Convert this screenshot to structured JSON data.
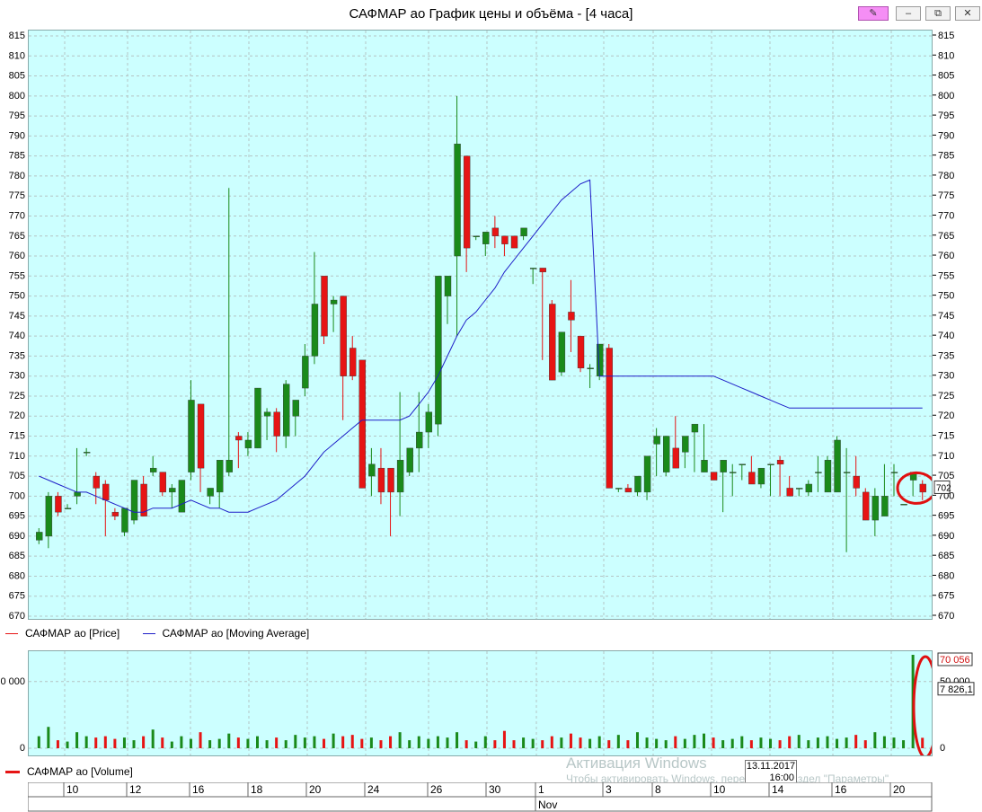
{
  "window": {
    "title": "САФМАР ао График цены и объёма - [4 часа]",
    "buttons": [
      "pin",
      "minimize",
      "restore",
      "close"
    ]
  },
  "legend": {
    "price": "САФМАР ао [Price]",
    "ma": "САФМАР ао [Moving Average]",
    "volume": "САФМАР ао [Volume]"
  },
  "price_axis": {
    "labels": [
      "815",
      "810",
      "805",
      "800",
      "795",
      "790",
      "785",
      "780",
      "775",
      "770",
      "765",
      "760",
      "755",
      "750",
      "745",
      "740",
      "735",
      "730",
      "725",
      "720",
      "715",
      "710",
      "705",
      "700",
      "695",
      "690",
      "685",
      "680",
      "675",
      "670"
    ],
    "current_label": "702"
  },
  "volume_axis": {
    "left_labels": [
      "0 000",
      "0"
    ],
    "right_labels": [
      "70 056",
      "50 000",
      "7 826,1",
      "0"
    ]
  },
  "time_axis": {
    "days": [
      "10",
      "12",
      "16",
      "18",
      "20",
      "24",
      "26",
      "30",
      "1",
      "3",
      "8",
      "10",
      "14",
      "16",
      "20"
    ],
    "month": "Nov"
  },
  "tooltip": {
    "date": "13.11.2017",
    "time": "16:00"
  },
  "watermark": {
    "line1": "Активация Windows",
    "line2": "Чтобы активировать Windows, перейдите в раздел \"Параметры\" компьютера."
  },
  "colors": {
    "up": "#1a8a1a",
    "down": "#e61414",
    "ma": "#1e1ec8",
    "bg": "#ccffff",
    "grid": "#b4c4c4",
    "highlight": "#e01010"
  },
  "chart_data": {
    "type": "candlestick",
    "title": "САФМАР ао График цены и объёма - [4 часа]",
    "ylim": [
      670,
      815
    ],
    "series": [
      {
        "name": "САФМАР ао [Price]",
        "ohlc": [
          [
            689,
            692,
            688,
            691
          ],
          [
            690,
            701,
            687,
            700
          ],
          [
            700,
            701,
            695,
            696
          ],
          [
            697,
            698,
            697,
            697
          ],
          [
            700,
            712,
            698,
            701
          ],
          [
            711,
            712,
            710,
            711
          ],
          [
            705,
            706,
            698,
            702
          ],
          [
            703,
            704,
            690,
            699
          ],
          [
            696,
            697,
            694,
            695
          ],
          [
            691,
            697,
            690,
            697
          ],
          [
            694,
            704,
            693,
            704
          ],
          [
            703,
            705,
            695,
            695
          ],
          [
            706,
            710,
            705,
            707
          ],
          [
            706,
            706,
            700,
            701
          ],
          [
            701,
            703,
            697,
            702
          ],
          [
            696,
            704,
            696,
            704
          ],
          [
            706,
            729,
            704,
            724
          ],
          [
            723,
            723,
            701,
            707
          ],
          [
            700,
            702,
            698,
            702
          ],
          [
            701,
            709,
            697,
            709
          ],
          [
            706,
            777,
            705,
            709
          ],
          [
            715,
            716,
            707,
            714
          ],
          [
            712,
            716,
            710,
            714
          ],
          [
            712,
            727,
            712,
            727
          ],
          [
            720,
            722,
            714,
            721
          ],
          [
            721,
            722,
            711,
            715
          ],
          [
            715,
            729,
            712,
            728
          ],
          [
            720,
            723,
            715,
            724
          ],
          [
            727,
            738,
            725,
            735
          ],
          [
            735,
            761,
            733,
            748
          ],
          [
            755,
            755,
            738,
            740
          ],
          [
            748,
            750,
            741,
            749
          ],
          [
            750,
            750,
            719,
            730
          ],
          [
            737,
            740,
            729,
            730
          ],
          [
            734,
            734,
            702,
            702
          ],
          [
            705,
            712,
            700,
            708
          ],
          [
            707,
            712,
            698,
            701
          ],
          [
            707,
            707,
            690,
            701
          ],
          [
            701,
            726,
            695,
            709
          ],
          [
            706,
            710,
            705,
            712
          ],
          [
            712,
            726,
            706,
            716
          ],
          [
            716,
            723,
            712,
            721
          ],
          [
            718,
            728,
            715,
            755
          ],
          [
            750,
            755,
            743,
            755
          ],
          [
            760,
            800,
            740,
            788
          ],
          [
            785,
            785,
            756,
            762
          ],
          [
            765,
            765,
            764,
            765
          ],
          [
            763,
            764,
            760,
            766
          ],
          [
            767,
            770,
            762,
            765
          ],
          [
            765,
            765,
            760,
            763
          ],
          [
            765,
            765,
            762,
            762
          ],
          [
            765,
            765,
            764,
            767
          ],
          [
            757,
            757,
            753,
            757
          ],
          [
            757,
            757,
            734,
            756
          ],
          [
            748,
            749,
            729,
            729
          ],
          [
            731,
            741,
            730,
            741
          ],
          [
            746,
            754,
            736,
            744
          ],
          [
            740,
            740,
            731,
            732
          ],
          [
            732,
            733,
            727,
            732
          ],
          [
            730,
            736,
            729,
            738
          ],
          [
            737,
            738,
            702,
            702
          ],
          [
            702,
            702,
            701,
            702
          ],
          [
            702,
            703,
            701,
            701
          ],
          [
            701,
            703,
            700,
            705
          ],
          [
            701,
            708,
            699,
            710
          ],
          [
            713,
            717,
            705,
            715
          ],
          [
            706,
            713,
            705,
            715
          ],
          [
            712,
            720,
            707,
            707
          ],
          [
            711,
            713,
            707,
            715
          ],
          [
            716,
            716,
            706,
            718
          ],
          [
            706,
            718,
            706,
            709
          ],
          [
            706,
            706,
            704,
            704
          ],
          [
            706,
            707,
            696,
            709
          ],
          [
            706,
            708,
            700,
            706
          ],
          [
            708,
            708,
            704,
            708
          ],
          [
            706,
            710,
            703,
            703
          ],
          [
            703,
            707,
            702,
            707
          ],
          [
            708,
            708,
            700,
            708
          ],
          [
            709,
            710,
            700,
            708
          ],
          [
            702,
            705,
            701,
            700
          ],
          [
            702,
            702,
            700,
            702
          ],
          [
            701,
            704,
            700,
            703
          ],
          [
            706,
            710,
            701,
            706
          ],
          [
            701,
            710,
            701,
            709
          ],
          [
            701,
            715,
            701,
            714
          ],
          [
            706,
            712,
            686,
            706
          ],
          [
            705,
            710,
            700,
            702
          ],
          [
            701,
            702,
            694,
            694
          ],
          [
            694,
            702,
            690,
            700
          ],
          [
            695,
            708,
            695,
            700
          ],
          [
            706,
            708,
            700,
            706
          ],
          [
            698,
            698,
            698,
            698
          ],
          [
            704,
            705,
            700,
            706
          ],
          [
            703,
            704,
            699,
            701
          ]
        ]
      },
      {
        "name": "САФМАР ао [Moving Average]",
        "values": [
          705,
          704,
          703,
          702,
          701,
          701,
          700,
          699,
          698,
          697,
          696,
          696,
          697,
          697,
          697,
          698,
          699,
          698,
          697,
          697,
          696,
          696,
          696,
          697,
          698,
          699,
          701,
          703,
          705,
          708,
          711,
          713,
          715,
          717,
          719,
          719,
          719,
          719,
          719,
          720,
          723,
          726,
          730,
          735,
          740,
          744,
          746,
          749,
          752,
          756,
          759,
          762,
          765,
          768,
          771,
          774,
          776,
          778,
          779,
          730,
          730,
          730,
          730,
          730,
          730,
          730,
          730,
          730,
          730,
          730,
          730,
          730,
          729,
          728,
          727,
          726,
          725,
          724,
          723,
          722,
          722,
          722,
          722,
          722,
          722,
          722,
          722,
          722,
          722,
          722,
          722,
          722,
          722,
          722
        ]
      },
      {
        "name": "САФМАР ао [Volume]",
        "values": [
          9000,
          16000,
          6000,
          5000,
          12000,
          9000,
          8000,
          9000,
          7000,
          8000,
          6000,
          9000,
          14000,
          8000,
          5000,
          9000,
          7000,
          12000,
          6000,
          7000,
          11000,
          8000,
          7000,
          9000,
          6000,
          8000,
          6000,
          10000,
          8000,
          9000,
          7000,
          11000,
          9000,
          10000,
          7000,
          8000,
          6000,
          9000,
          12000,
          6000,
          9000,
          7000,
          9000,
          8000,
          12000,
          6000,
          5000,
          9000,
          6000,
          13000,
          6000,
          8000,
          7000,
          6000,
          9000,
          8000,
          11000,
          8000,
          7000,
          9000,
          6000,
          10000,
          6000,
          12000,
          8000,
          7000,
          6000,
          9000,
          7000,
          10000,
          11000,
          8000,
          6000,
          7000,
          9000,
          6000,
          8000,
          7000,
          6000,
          9000,
          10000,
          6000,
          8000,
          9000,
          7000,
          8000,
          10000,
          6000,
          12000,
          9000,
          8000,
          6000,
          70056,
          7826
        ]
      }
    ]
  }
}
